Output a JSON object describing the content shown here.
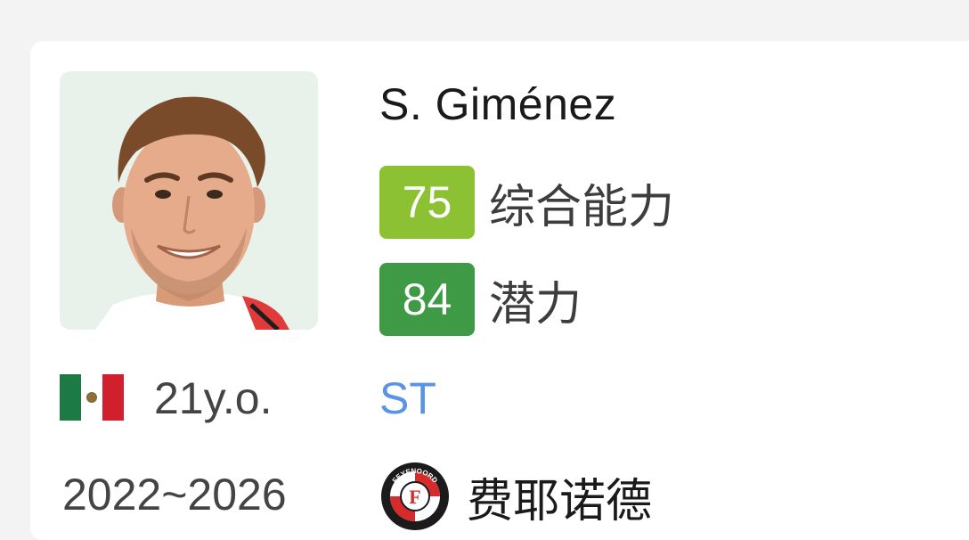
{
  "player": {
    "name": "S. Giménez",
    "photo_icon": "player-portrait",
    "nationality_flag_icon": "mexico-flag-icon",
    "age": "21y.o.",
    "position": "ST",
    "contract": "2022~2026"
  },
  "ratings": {
    "overall": {
      "value": "75",
      "label": "综合能力",
      "color": "#8bc132"
    },
    "potential": {
      "value": "84",
      "label": "潜力",
      "color": "#3f9a45"
    }
  },
  "club": {
    "name": "费耶诺德",
    "logo_icon": "feyenoord-crest-icon",
    "logo_text": "FEYENOORD"
  },
  "colors": {
    "position_text": "#5b93e5",
    "card_background": "#ffffff",
    "page_background": "#f3f3f3"
  }
}
